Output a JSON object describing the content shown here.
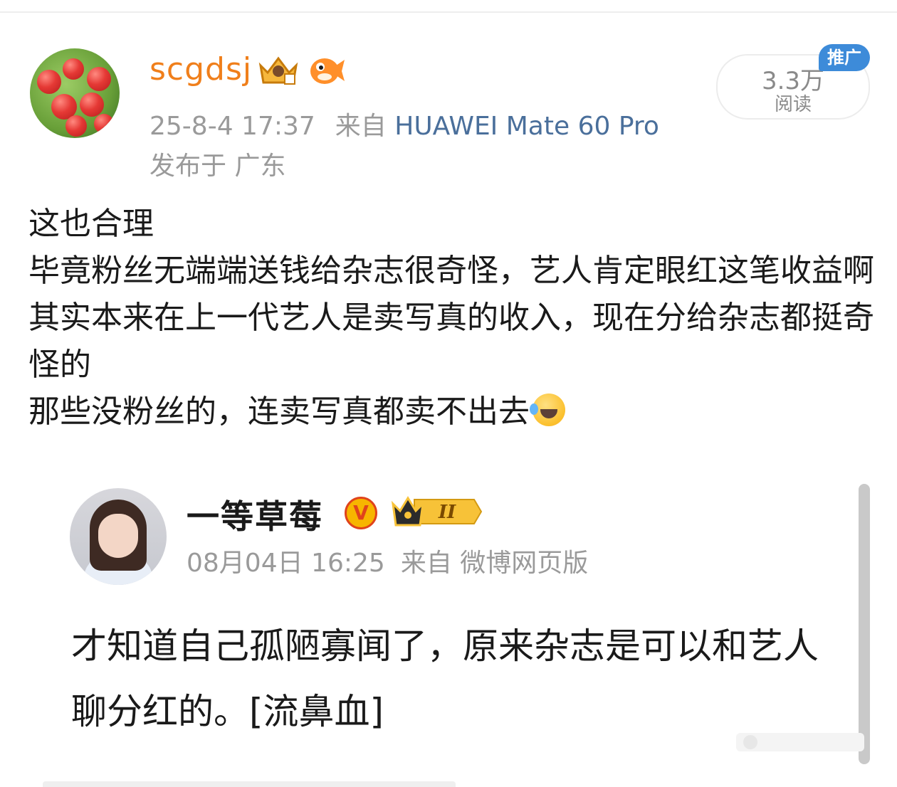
{
  "post": {
    "author": {
      "username": "scgdsj",
      "avatar_icon": "apples-avatar",
      "badges": [
        "crown-level-badge-icon",
        "pufferfish-badge-icon"
      ],
      "timestamp": "25-8-4 17:37",
      "source_prefix": "来自",
      "device": "HUAWEI Mate 60 Pro",
      "location": "发布于 广东"
    },
    "stats": {
      "reads_value": "3.3万",
      "reads_label": "阅读",
      "promo_tag": "推广"
    },
    "body_lines": [
      "这也合理",
      "毕竟粉丝无端端送钱给杂志很奇怪，艺人肯定眼红这笔收益啊",
      "其实本来在上一代艺人是卖写真的收入，现在分给杂志都挺奇怪的",
      "那些没粉丝的，连卖写真都卖不出去"
    ],
    "body_end_emoji": "laugh-cry-emoji-icon"
  },
  "quoted_post": {
    "author": {
      "name": "一等草莓",
      "verified_icon": "verified-v-icon",
      "verified_mark": "V",
      "level_badge": "crown-level-2-icon",
      "level_text": "II",
      "timestamp": "08月04日 16:25",
      "source": "来自 微博网页版"
    },
    "text": "才知道自己孤陋寡闻了，原来杂志是可以和艺人聊分红的。[流鼻血]"
  },
  "colors": {
    "username": "#f07f1b",
    "device_link": "#4a6f9b",
    "meta_gray": "#9a9a9a",
    "promo_blue": "#3d8bd9",
    "verified_gold": "#f7b500",
    "verified_red": "#e0431b"
  }
}
